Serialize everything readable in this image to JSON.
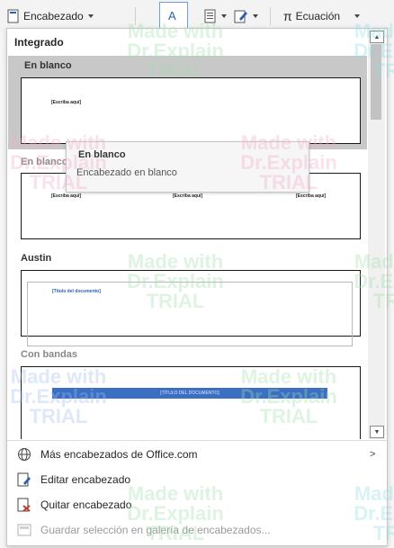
{
  "ribbon": {
    "header_btn": "Encabezado",
    "equation_btn": "Ecuación",
    "pi_symbol": "π"
  },
  "gallery": {
    "section_integrated": "Integrado",
    "section_office": "Austin",
    "items": [
      {
        "label": "En blanco",
        "placeholder": "[Escriba aquí]"
      },
      {
        "label": "En blanco (tres columnas)",
        "placeholders": [
          "[Escriba aquí]",
          "[Escriba aquí]",
          "[Escriba aquí]"
        ]
      },
      {
        "label": "Austin",
        "placeholder": "[Título del documento]"
      },
      {
        "label": "Con bandas",
        "placeholder": "[TÍTULO DEL DOCUMENTO]"
      }
    ]
  },
  "tooltip": {
    "title": "En blanco",
    "description": "Encabezado en blanco"
  },
  "commands": {
    "more_headers": "Más encabezados de Office.com",
    "edit_header": "Editar encabezado",
    "remove_header": "Quitar encabezado",
    "save_selection": "Guardar selección en galería de encabezados..."
  },
  "watermark": {
    "line1": "Made with",
    "line2": "Dr.Explain",
    "line3": "TRIAL"
  },
  "colors": {
    "selection": "#c8c8c8",
    "banded_title": "#3a6fc4"
  }
}
